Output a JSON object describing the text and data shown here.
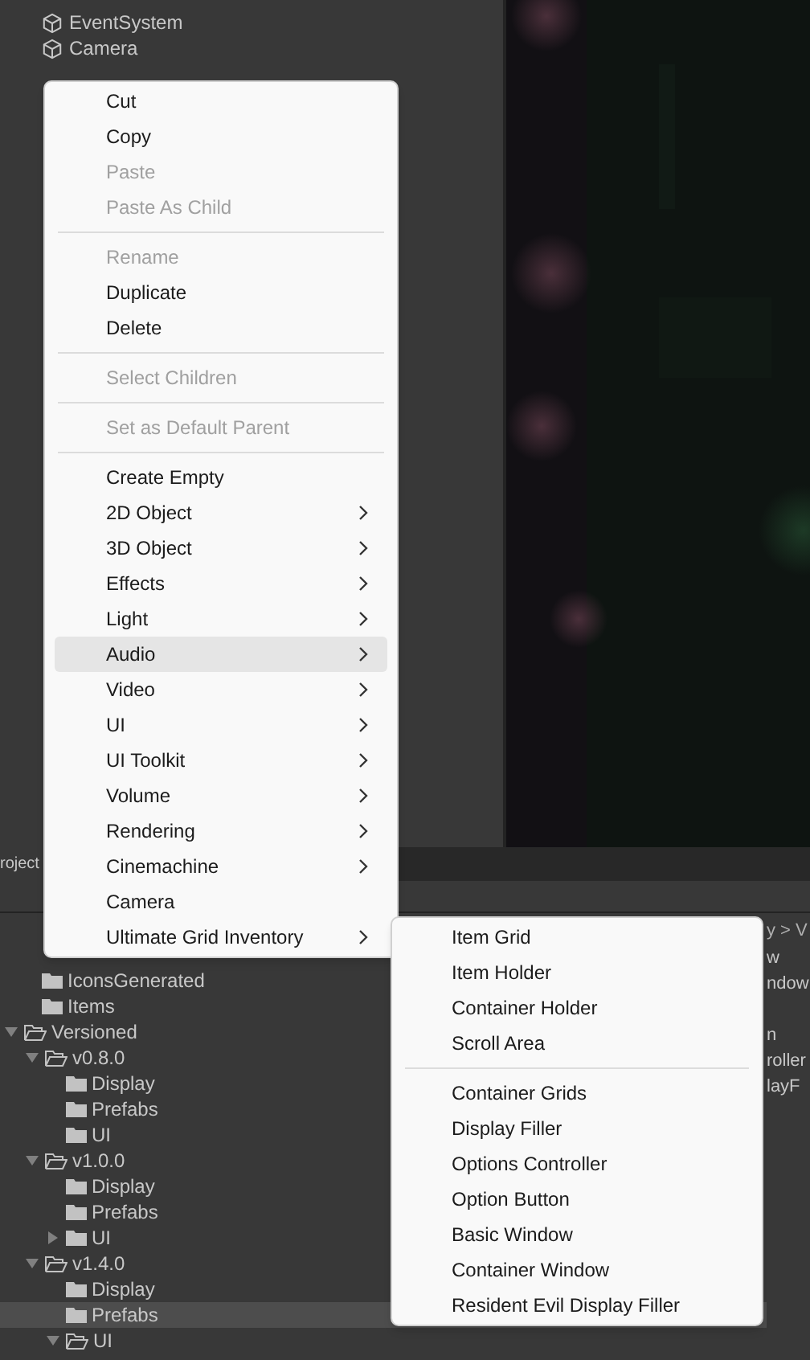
{
  "hierarchy": {
    "items": [
      {
        "label": "EventSystem"
      },
      {
        "label": "Camera"
      }
    ]
  },
  "project_panel": {
    "tab": "roject",
    "loose_folders": [
      "IconsGenerated",
      "Items"
    ],
    "tree": [
      {
        "label": "Versioned",
        "expanded": true,
        "selected": false,
        "children": [
          {
            "label": "v0.8.0",
            "expanded": true,
            "selected": false,
            "children": [
              {
                "label": "Display",
                "selected": false
              },
              {
                "label": "Prefabs",
                "selected": false
              },
              {
                "label": "UI",
                "selected": false
              }
            ]
          },
          {
            "label": "v1.0.0",
            "expanded": true,
            "selected": false,
            "children": [
              {
                "label": "Display",
                "selected": false
              },
              {
                "label": "Prefabs",
                "selected": false
              },
              {
                "label": "UI",
                "expanded": false,
                "selected": false
              }
            ]
          },
          {
            "label": "v1.4.0",
            "expanded": true,
            "selected": false,
            "children": [
              {
                "label": "Display",
                "selected": false
              },
              {
                "label": "Prefabs",
                "selected": true
              },
              {
                "label": "UI",
                "expanded": true,
                "selected": false
              }
            ]
          }
        ]
      }
    ],
    "breadcrumb": "y > V",
    "file_groups": [
      [
        "w",
        "ndow"
      ],
      [
        "n",
        "roller",
        "layF"
      ]
    ]
  },
  "context_menu": {
    "items": [
      {
        "kind": "item",
        "label": "Cut",
        "disabled": false,
        "submenu": false,
        "highlighted": false
      },
      {
        "kind": "item",
        "label": "Copy",
        "disabled": false,
        "submenu": false,
        "highlighted": false
      },
      {
        "kind": "item",
        "label": "Paste",
        "disabled": true,
        "submenu": false,
        "highlighted": false
      },
      {
        "kind": "item",
        "label": "Paste As Child",
        "disabled": true,
        "submenu": false,
        "highlighted": false
      },
      {
        "kind": "separator"
      },
      {
        "kind": "item",
        "label": "Rename",
        "disabled": true,
        "submenu": false,
        "highlighted": false
      },
      {
        "kind": "item",
        "label": "Duplicate",
        "disabled": false,
        "submenu": false,
        "highlighted": false
      },
      {
        "kind": "item",
        "label": "Delete",
        "disabled": false,
        "submenu": false,
        "highlighted": false
      },
      {
        "kind": "separator"
      },
      {
        "kind": "item",
        "label": "Select Children",
        "disabled": true,
        "submenu": false,
        "highlighted": false
      },
      {
        "kind": "separator"
      },
      {
        "kind": "item",
        "label": "Set as Default Parent",
        "disabled": true,
        "submenu": false,
        "highlighted": false
      },
      {
        "kind": "separator"
      },
      {
        "kind": "item",
        "label": "Create Empty",
        "disabled": false,
        "submenu": false,
        "highlighted": false
      },
      {
        "kind": "item",
        "label": "2D Object",
        "disabled": false,
        "submenu": true,
        "highlighted": false
      },
      {
        "kind": "item",
        "label": "3D Object",
        "disabled": false,
        "submenu": true,
        "highlighted": false
      },
      {
        "kind": "item",
        "label": "Effects",
        "disabled": false,
        "submenu": true,
        "highlighted": false
      },
      {
        "kind": "item",
        "label": "Light",
        "disabled": false,
        "submenu": true,
        "highlighted": false
      },
      {
        "kind": "item",
        "label": "Audio",
        "disabled": false,
        "submenu": true,
        "highlighted": true
      },
      {
        "kind": "item",
        "label": "Video",
        "disabled": false,
        "submenu": true,
        "highlighted": false
      },
      {
        "kind": "item",
        "label": "UI",
        "disabled": false,
        "submenu": true,
        "highlighted": false
      },
      {
        "kind": "item",
        "label": "UI Toolkit",
        "disabled": false,
        "submenu": true,
        "highlighted": false
      },
      {
        "kind": "item",
        "label": "Volume",
        "disabled": false,
        "submenu": true,
        "highlighted": false
      },
      {
        "kind": "item",
        "label": "Rendering",
        "disabled": false,
        "submenu": true,
        "highlighted": false
      },
      {
        "kind": "item",
        "label": "Cinemachine",
        "disabled": false,
        "submenu": true,
        "highlighted": false
      },
      {
        "kind": "item",
        "label": "Camera",
        "disabled": false,
        "submenu": false,
        "highlighted": false
      },
      {
        "kind": "item",
        "label": "Ultimate Grid Inventory",
        "disabled": false,
        "submenu": true,
        "highlighted": false
      }
    ]
  },
  "submenu": {
    "items": [
      {
        "kind": "item",
        "label": "Item Grid"
      },
      {
        "kind": "item",
        "label": "Item Holder"
      },
      {
        "kind": "item",
        "label": "Container Holder"
      },
      {
        "kind": "item",
        "label": "Scroll Area"
      },
      {
        "kind": "separator"
      },
      {
        "kind": "item",
        "label": "Container Grids"
      },
      {
        "kind": "item",
        "label": "Display Filler"
      },
      {
        "kind": "item",
        "label": "Options Controller"
      },
      {
        "kind": "item",
        "label": "Option Button"
      },
      {
        "kind": "item",
        "label": "Basic Window"
      },
      {
        "kind": "item",
        "label": "Container Window"
      },
      {
        "kind": "item",
        "label": "Resident Evil Display Filler"
      }
    ]
  }
}
